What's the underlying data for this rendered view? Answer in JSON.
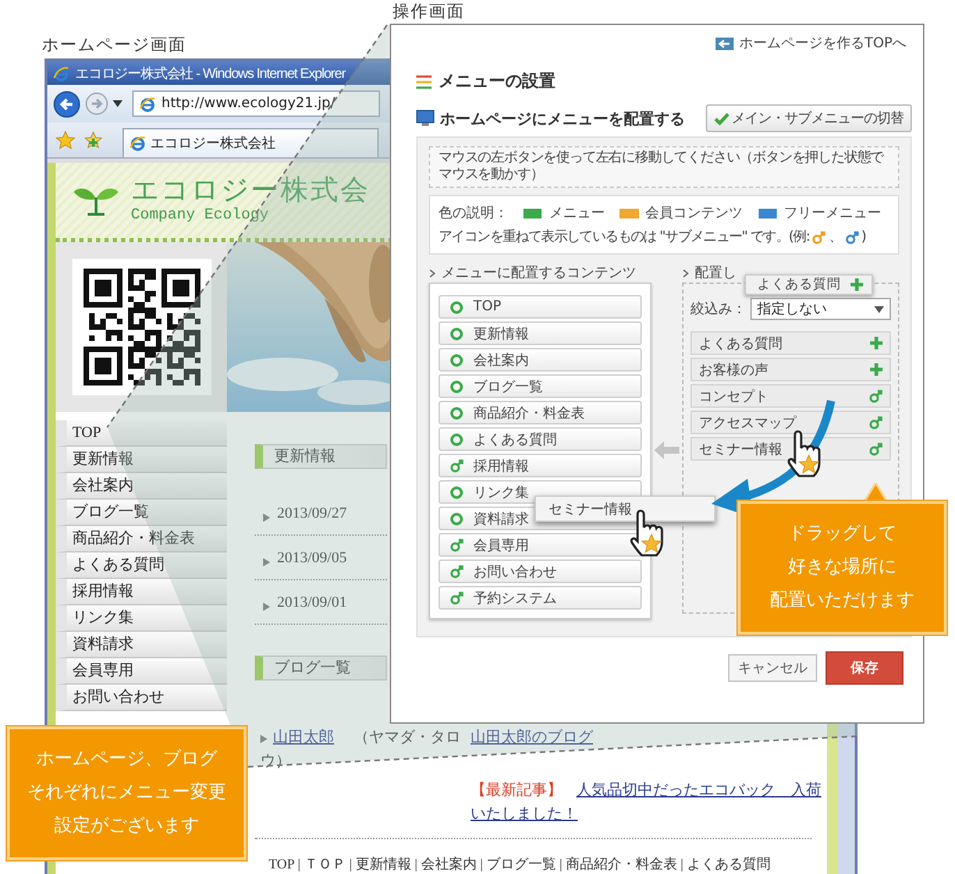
{
  "labels": {
    "homepage": "ホームページ画面",
    "operation": "操作画面"
  },
  "browser": {
    "title": "エコロジー株式会社 - Windows Internet Explorer",
    "address": "http://www.ecology21.jp/",
    "tab": "エコロジー株式会社"
  },
  "site": {
    "logo": "エコロジー株式会",
    "logo_sub": "Company Ecology",
    "nav": [
      "TOP",
      "更新情報",
      "会社案内",
      "ブログ一覧",
      "商品紹介・料金表",
      "よくある質問",
      "採用情報",
      "リンク集",
      "資料請求",
      "会員専用",
      "お問い合わせ"
    ],
    "news": {
      "heading": "更新情報",
      "dates": [
        "2013/09/27",
        "2013/09/05",
        "2013/09/01"
      ]
    },
    "blog": {
      "heading": "ブログ一覧",
      "author": "山田太郎",
      "reading_lines": [
        "（ヤマダ・タロ",
        "ウ）"
      ],
      "blog_link": "山田太郎のブログ",
      "tag": "【最新記事】",
      "article_lines": [
        "人気品切中だったエコバック　入荷",
        "いたしました！"
      ]
    },
    "footer": "TOP | ＴＯＰ | 更新情報 | 会社案内 | ブログ一覧 | 商品紹介・料金表 | よくある質問"
  },
  "operation": {
    "top_link": "ホームページを作るTOPへ",
    "title": "メニューの設置",
    "section": "ホームページにメニューを配置する",
    "switch_button": "メイン・サブメニューの切替",
    "instruction": "マウスの左ボタンを使って左右に移動してください（ボタンを押した状態でマウスを動かす）",
    "legend": {
      "label": "色の説明：",
      "items": [
        {
          "label": "メニュー",
          "color": "#3aaa4a"
        },
        {
          "label": "会員コンテンツ",
          "color": "#f0a830"
        },
        {
          "label": "フリーメニュー",
          "color": "#3a88d0"
        }
      ],
      "note": "アイコンを重ねて表示しているものは \"サブメニュー\" です。(例:",
      "examples": [
        {
          "color": "#f0a020"
        },
        {
          "color": "#3a88d0"
        }
      ],
      "note_sep": "、",
      "note_end": ")"
    },
    "available": {
      "heading": "メニューに配置するコンテンツ",
      "items": [
        {
          "label": "TOP",
          "kind": "menu"
        },
        {
          "label": "更新情報",
          "kind": "menu"
        },
        {
          "label": "会社案内",
          "kind": "menu"
        },
        {
          "label": "ブログ一覧",
          "kind": "menu"
        },
        {
          "label": "商品紹介・料金表",
          "kind": "menu"
        },
        {
          "label": "よくある質問",
          "kind": "menu"
        },
        {
          "label": "採用情報",
          "kind": "submenu"
        },
        {
          "label": "リンク集",
          "kind": "menu"
        },
        {
          "label": "資料請求",
          "kind": "menu"
        },
        {
          "label": "会員専用",
          "kind": "submenu"
        },
        {
          "label": "お問い合わせ",
          "kind": "submenu"
        },
        {
          "label": "予約システム",
          "kind": "submenu"
        }
      ]
    },
    "placed": {
      "heading": "配置し",
      "filter_label": "絞込み：",
      "filter_value": "指定しない",
      "items": [
        {
          "label": "よくある質問",
          "kind": "add"
        },
        {
          "label": "お客様の声",
          "kind": "add"
        },
        {
          "label": "コンセプト",
          "kind": "submenu"
        },
        {
          "label": "アクセスマップ",
          "kind": "submenu"
        },
        {
          "label": "セミナー情報",
          "kind": "submenu"
        }
      ]
    },
    "floating_item": "よくある質問",
    "drag_item": "セミナー情報",
    "cancel": "キャンセル",
    "save": "保存"
  },
  "callouts": [
    {
      "lines": [
        "ドラッグして",
        "好きな場所に",
        "配置いただけます"
      ],
      "pointer": true
    },
    {
      "lines": [
        "ホームページ、ブログ",
        "それぞれにメニュー変更",
        "設定がございます"
      ],
      "pointer": false
    }
  ]
}
